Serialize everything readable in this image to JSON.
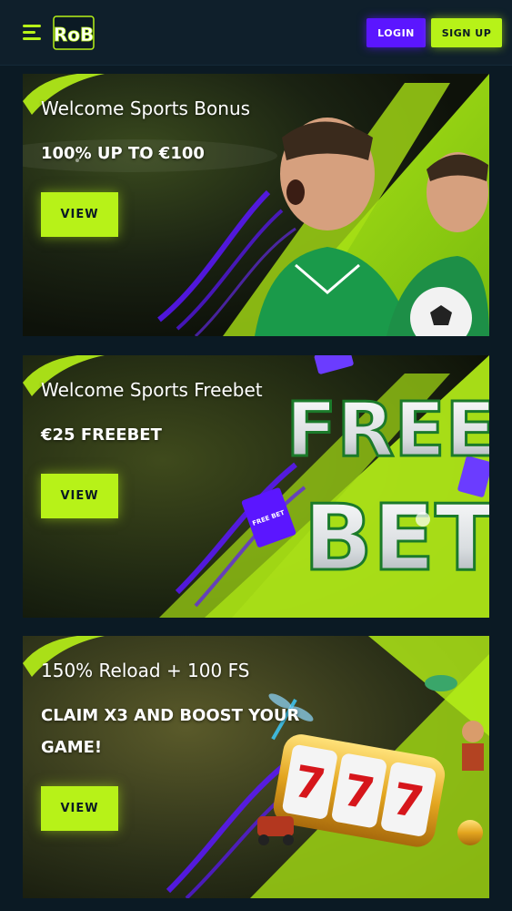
{
  "header": {
    "logo_text": "RoB",
    "login_label": "LOGIN",
    "signup_label": "SIGN UP"
  },
  "colors": {
    "background": "#0b1a24",
    "header": "#0f1f2b",
    "accent_lime": "#b7f218",
    "accent_purple": "#5b16ff"
  },
  "promos": [
    {
      "title": "Welcome Sports Bonus",
      "subtitle": "100% UP TO €100",
      "button_label": "VIEW",
      "art": "football-players"
    },
    {
      "title": "Welcome Sports Freebet",
      "subtitle": "€25 FREEBET",
      "button_label": "VIEW",
      "art": "free-bet-text",
      "art_text": {
        "line1": "FREE",
        "line2": "BET",
        "ticket": "FREE BET"
      }
    },
    {
      "title": "150% Reload + 100 FS",
      "subtitle": "CLAIM X3 AND BOOST YOUR GAME!",
      "button_label": "VIEW",
      "art": "slot-reels-777",
      "art_text": {
        "reel1": "7",
        "reel2": "7",
        "reel3": "7"
      }
    }
  ]
}
